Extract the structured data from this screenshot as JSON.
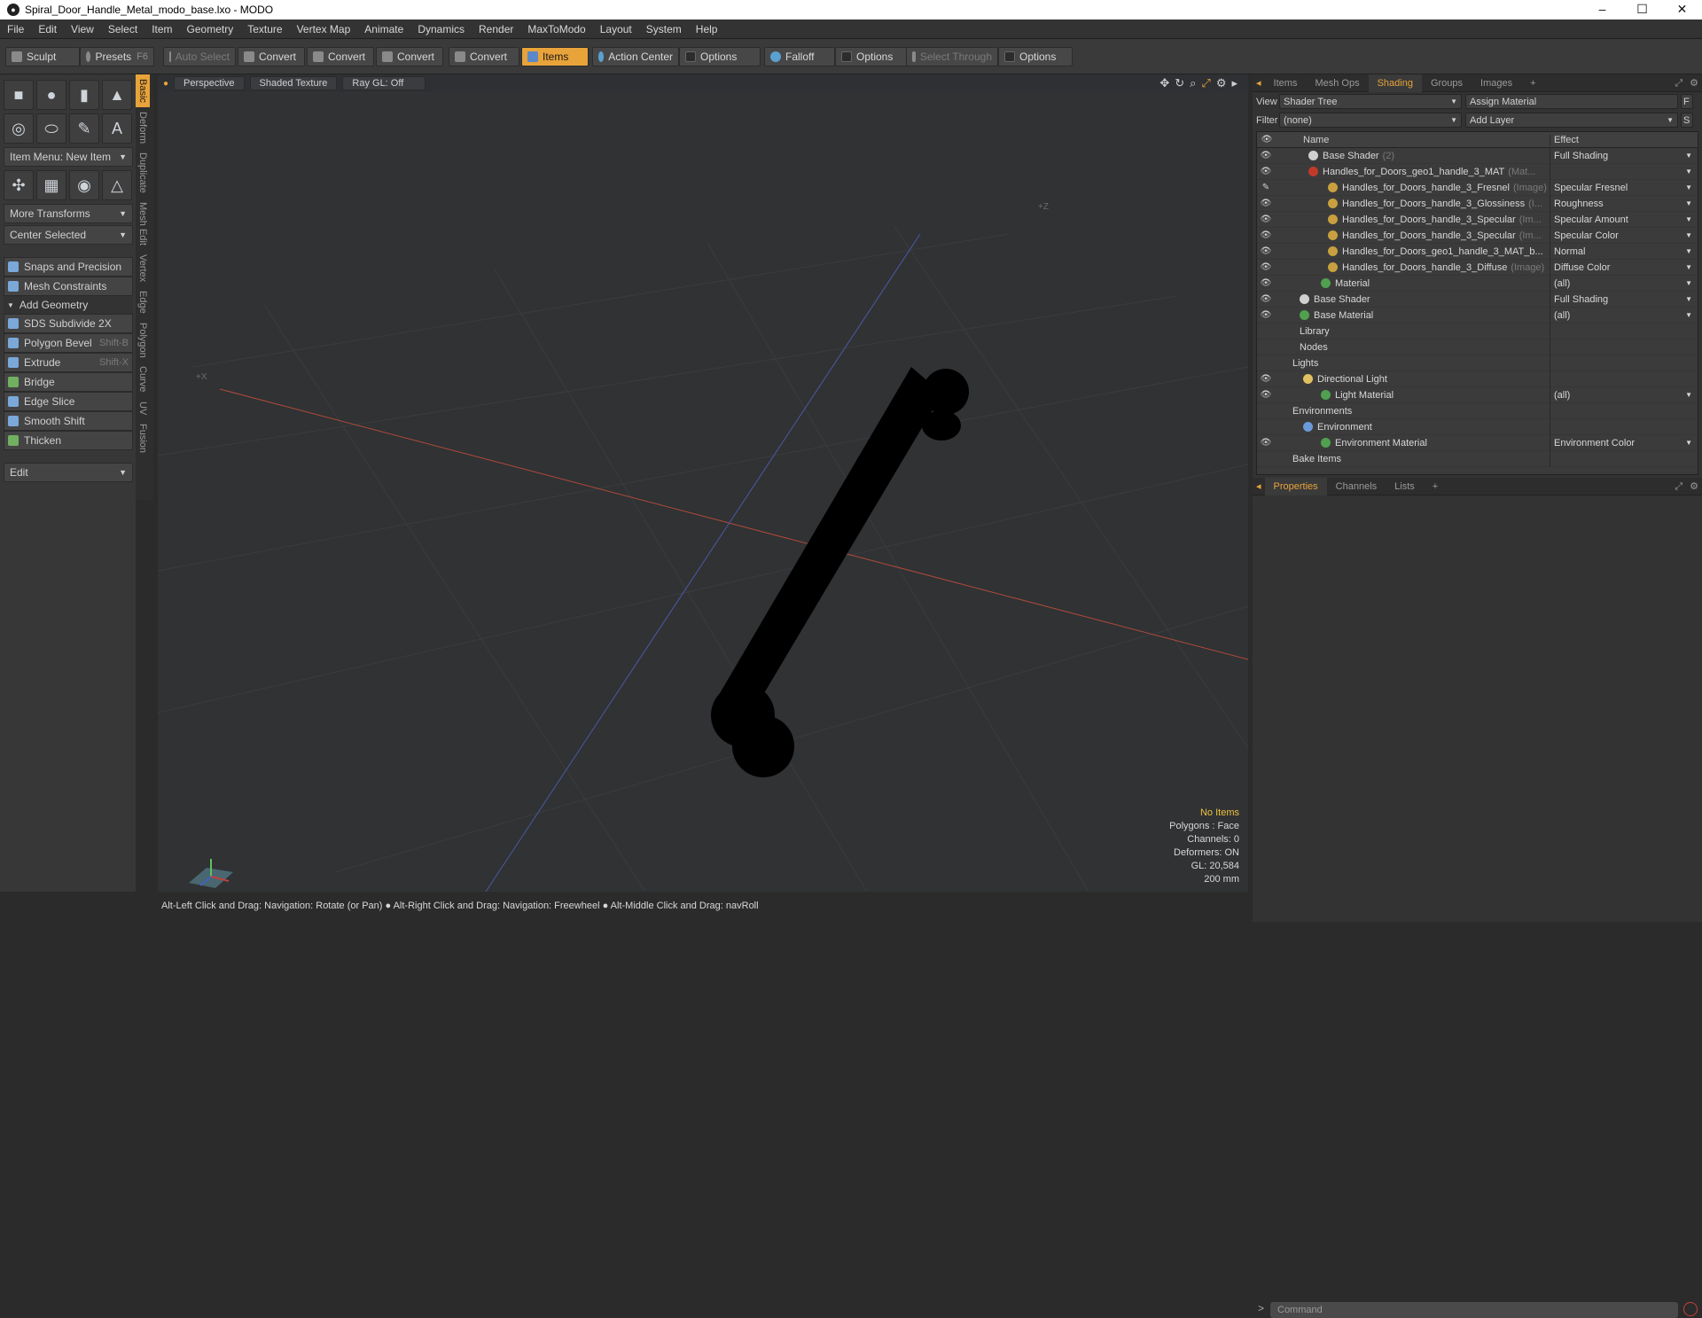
{
  "window": {
    "title": "Spiral_Door_Handle_Metal_modo_base.lxo - MODO",
    "minimize": "–",
    "maximize": "☐",
    "close": "✕"
  },
  "menu": [
    "File",
    "Edit",
    "View",
    "Select",
    "Item",
    "Geometry",
    "Texture",
    "Vertex Map",
    "Animate",
    "Dynamics",
    "Render",
    "MaxToModo",
    "Layout",
    "System",
    "Help"
  ],
  "toolbar": {
    "sculpt": "Sculpt",
    "presets": "Presets",
    "presets_key": "F6",
    "auto_select": "Auto Select",
    "convert1": "Convert",
    "convert2": "Convert",
    "convert3": "Convert",
    "convert4": "Convert",
    "items": "Items",
    "action_center": "Action Center",
    "options1": "Options",
    "falloff": "Falloff",
    "options2": "Options",
    "select_through": "Select Through",
    "options3": "Options"
  },
  "left": {
    "item_menu": "Item Menu: New Item",
    "more_transforms": "More Transforms",
    "center_selected": "Center Selected",
    "snaps": "Snaps and Precision",
    "mesh_constraints": "Mesh Constraints",
    "add_geometry": "Add Geometry",
    "tools": [
      {
        "label": "SDS Subdivide 2X",
        "key": ""
      },
      {
        "label": "Polygon Bevel",
        "key": "Shift-B"
      },
      {
        "label": "Extrude",
        "key": "Shift-X"
      },
      {
        "label": "Bridge",
        "key": ""
      },
      {
        "label": "Edge Slice",
        "key": ""
      },
      {
        "label": "Smooth Shift",
        "key": ""
      },
      {
        "label": "Thicken",
        "key": ""
      }
    ],
    "edit": "Edit"
  },
  "vtabs": [
    "Basic",
    "Deform",
    "Duplicate",
    "Mesh Edit",
    "Vertex",
    "Edge",
    "Polygon",
    "Curve",
    "UV",
    "Fusion"
  ],
  "viewport": {
    "perspective": "Perspective",
    "shading": "Shaded Texture",
    "raygl": "Ray GL: Off",
    "axis_z": "+Z",
    "axis_x": "+X",
    "hud": {
      "items": "No Items",
      "polygons": "Polygons : Face",
      "channels": "Channels: 0",
      "deformers": "Deformers: ON",
      "gl": "GL: 20,584",
      "scale": "200 mm"
    },
    "colors": {
      "bg": "#303234",
      "grid": "#3a3c3f",
      "x_axis": "#b04a3a",
      "z_axis": "#4a5aa8",
      "mesh": "#000000"
    }
  },
  "status": "Alt-Left Click and Drag: Navigation: Rotate (or Pan) ● Alt-Right Click and Drag: Navigation: Freewheel ● Alt-Middle Click and Drag: navRoll",
  "right": {
    "tabs": [
      "Items",
      "Mesh Ops",
      "Shading",
      "Groups",
      "Images"
    ],
    "active_tab": "Shading",
    "add": "+",
    "view_label": "View",
    "view_value": "Shader Tree",
    "assign": "Assign Material",
    "filter_label": "Filter",
    "filter_value": "(none)",
    "add_layer": "Add Layer",
    "f_btn": "F",
    "s_btn": "S",
    "col_name": "Name",
    "col_effect": "Effect",
    "rows": [
      {
        "indent": 58,
        "eye": "👁",
        "icon": "#d0d0d0",
        "name": "Base Shader",
        "suffix": "(2)",
        "effect": "Full Shading",
        "arrow": true
      },
      {
        "indent": 58,
        "eye": "👁",
        "icon": "#c03a2a",
        "name": "Handles_for_Doors_geo1_handle_3_MAT",
        "suffix": "(Mat...",
        "effect": "",
        "arrow": true
      },
      {
        "indent": 80,
        "eye": "✎",
        "icon": "#c8a040",
        "name": "Handles_for_Doors_handle_3_Fresnel",
        "suffix": "(Image)",
        "effect": "Specular Fresnel",
        "arrow": true
      },
      {
        "indent": 80,
        "eye": "👁",
        "icon": "#c8a040",
        "name": "Handles_for_Doors_handle_3_Glossiness",
        "suffix": "(I...",
        "effect": "Roughness",
        "arrow": true
      },
      {
        "indent": 80,
        "eye": "👁",
        "icon": "#c8a040",
        "name": "Handles_for_Doors_handle_3_Specular",
        "suffix": "(Im...",
        "effect": "Specular Amount",
        "arrow": true
      },
      {
        "indent": 80,
        "eye": "👁",
        "icon": "#c8a040",
        "name": "Handles_for_Doors_handle_3_Specular",
        "suffix": "(Im...",
        "effect": "Specular Color",
        "arrow": true
      },
      {
        "indent": 80,
        "eye": "👁",
        "icon": "#c8a040",
        "name": "Handles_for_Doors_geo1_handle_3_MAT_b...",
        "suffix": "",
        "effect": "Normal",
        "arrow": true
      },
      {
        "indent": 80,
        "eye": "👁",
        "icon": "#c8a040",
        "name": "Handles_for_Doors_handle_3_Diffuse",
        "suffix": "(Image)",
        "effect": "Diffuse Color",
        "arrow": true
      },
      {
        "indent": 72,
        "eye": "👁",
        "icon": "#50a050",
        "name": "Material",
        "suffix": "",
        "effect": "(all)",
        "arrow": true
      },
      {
        "indent": 48,
        "eye": "👁",
        "icon": "#d0d0d0",
        "name": "Base Shader",
        "suffix": "",
        "effect": "Full Shading",
        "arrow": true
      },
      {
        "indent": 48,
        "eye": "👁",
        "icon": "#50a050",
        "name": "Base Material",
        "suffix": "",
        "effect": "(all)",
        "arrow": true
      },
      {
        "indent": 48,
        "eye": "",
        "icon": "",
        "name": "Library",
        "suffix": "",
        "effect": "",
        "arrow": false
      },
      {
        "indent": 48,
        "eye": "",
        "icon": "",
        "name": "Nodes",
        "suffix": "",
        "effect": "",
        "arrow": false
      },
      {
        "indent": 40,
        "eye": "",
        "icon": "",
        "name": "Lights",
        "suffix": "",
        "effect": "",
        "arrow": false
      },
      {
        "indent": 52,
        "eye": "👁",
        "icon": "#e0c060",
        "name": "Directional Light",
        "suffix": "",
        "effect": "",
        "arrow": false
      },
      {
        "indent": 72,
        "eye": "👁",
        "icon": "#50a050",
        "name": "Light Material",
        "suffix": "",
        "effect": "(all)",
        "arrow": true
      },
      {
        "indent": 40,
        "eye": "",
        "icon": "",
        "name": "Environments",
        "suffix": "",
        "effect": "",
        "arrow": false
      },
      {
        "indent": 52,
        "eye": "",
        "icon": "#6a9ad8",
        "name": "Environment",
        "suffix": "",
        "effect": "",
        "arrow": false
      },
      {
        "indent": 72,
        "eye": "👁",
        "icon": "#50a050",
        "name": "Environment Material",
        "suffix": "",
        "effect": "Environment Color",
        "arrow": true
      },
      {
        "indent": 40,
        "eye": "",
        "icon": "",
        "name": "Bake Items",
        "suffix": "",
        "effect": "",
        "arrow": false
      }
    ],
    "prop_tabs": [
      "Properties",
      "Channels",
      "Lists"
    ],
    "command": "Command"
  }
}
